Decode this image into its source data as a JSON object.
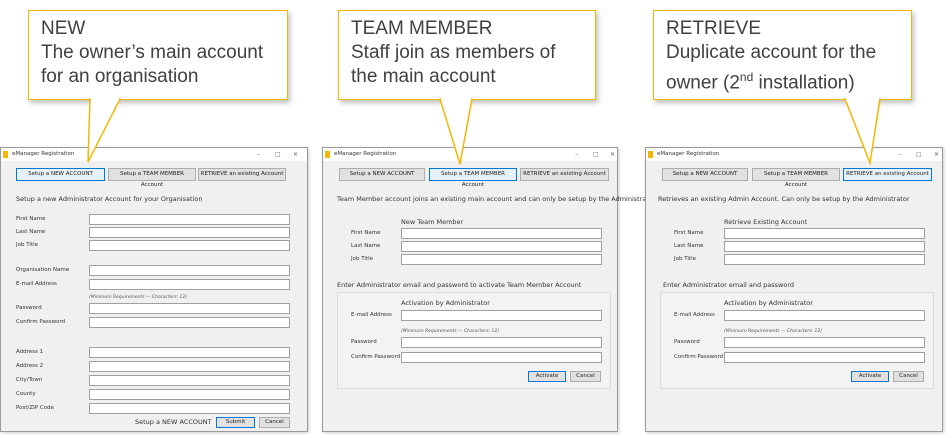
{
  "callouts": [
    {
      "title": "NEW",
      "line1": "The owner’s main account",
      "line2": "for an organisation"
    },
    {
      "title": "TEAM MEMBER",
      "line1": "Staff join as members of",
      "line2": "the main account"
    },
    {
      "title": "RETRIEVE",
      "line1": "Duplicate account for the",
      "line2_pre": "owner (2",
      "line2_sup": "nd",
      "line2_post": " installation)"
    }
  ],
  "colors": {
    "callout_border": "#f2b705",
    "selected_tab": "#0078d7",
    "logo": "#f2b705"
  },
  "window_title": "eManager Registration",
  "tabs": [
    "Setup a NEW ACCOUNT",
    "Setup a TEAM MEMBER Account",
    "RETRIEVE an existing Account"
  ],
  "min_req": "(Minimum Requirements — Characters: 12)",
  "new": {
    "description": "Setup a new Administrator Account for your Organisation",
    "fields": [
      "First Name",
      "Last Name",
      "Job Title",
      "Organisation Name",
      "E-mail Address",
      "Password",
      "Confirm Password",
      "Address 1",
      "Address 2",
      "City/Town",
      "County",
      "Post/ZIP Code"
    ],
    "footer": "Setup a NEW ACCOUNT",
    "submit": "Submit",
    "cancel": "Cancel"
  },
  "team": {
    "description": "Team Member account joins an existing main account and can only be setup by the Administrator",
    "heading": "New Team Member",
    "fields": [
      "First Name",
      "Last Name",
      "Job Title"
    ],
    "admin_prompt": "Enter Administrator email and password to activate Team Member Account",
    "admin_heading": "Activation by Administrator",
    "admin_fields": [
      "E-mail Address",
      "Password",
      "Confirm Password"
    ],
    "activate": "Activate",
    "cancel": "Cancel"
  },
  "retrieve": {
    "description": "Retrieves an existing Admin Account. Can only be setup by the Administrator",
    "heading": "Retrieve Existing Account",
    "fields": [
      "First Name",
      "Last Name",
      "Job Title"
    ],
    "admin_prompt": "Enter Administrator email and password",
    "admin_heading": "Activation by Administrator",
    "admin_fields": [
      "E-mail Address",
      "Password",
      "Confirm Password"
    ],
    "activate": "Activate",
    "cancel": "Cancel"
  }
}
